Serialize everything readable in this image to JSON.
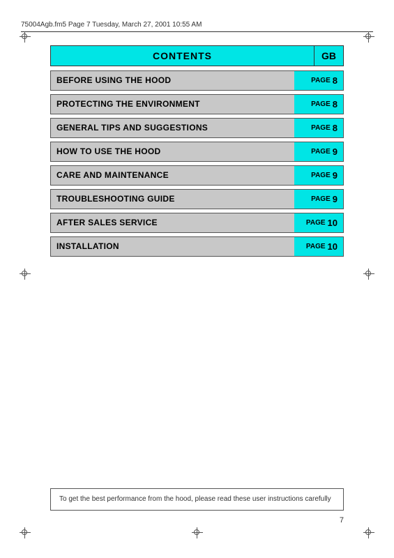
{
  "header": {
    "filename": "75004Agb.fm5  Page 7  Tuesday, March 27, 2001  10:55 AM"
  },
  "contents_title": "CONTENTS",
  "gb_label": "GB",
  "toc_items": [
    {
      "label": "BEFORE USING THE HOOD",
      "page_label": "PAGE",
      "page_num": "8"
    },
    {
      "label": "PROTECTING THE ENVIRONMENT",
      "page_label": "PAGE",
      "page_num": "8"
    },
    {
      "label": "GENERAL TIPS AND SUGGESTIONS",
      "page_label": "PAGE",
      "page_num": "8"
    },
    {
      "label": "HOW TO USE THE HOOD",
      "page_label": "PAGE",
      "page_num": "9"
    },
    {
      "label": "CARE AND MAINTENANCE",
      "page_label": "PAGE",
      "page_num": "9"
    },
    {
      "label": "TROUBLESHOOTING GUIDE",
      "page_label": "PAGE",
      "page_num": "9"
    },
    {
      "label": "AFTER SALES SERVICE",
      "page_label": "PAGE",
      "page_num": "10"
    },
    {
      "label": "INSTALLATION",
      "page_label": "PAGE",
      "page_num": "10"
    }
  ],
  "footer_note": "To get the best performance from the hood, please read these user instructions carefully",
  "page_number": "7"
}
